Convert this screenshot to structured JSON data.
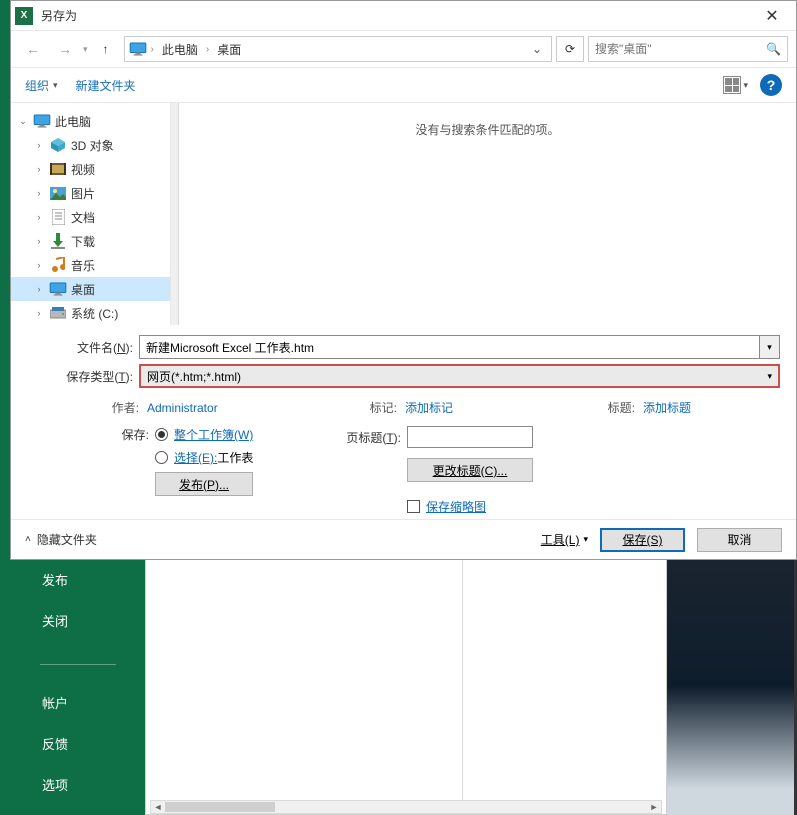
{
  "titlebar": {
    "title": "另存为"
  },
  "nav": {
    "crumb1": "此电脑",
    "crumb2": "桌面",
    "search_placeholder": "搜索\"桌面\""
  },
  "toolbar": {
    "organize": "组织",
    "new_folder": "新建文件夹"
  },
  "tree": {
    "root": "此电脑",
    "items": [
      {
        "label": "3D 对象",
        "icon": "cube"
      },
      {
        "label": "视频",
        "icon": "video"
      },
      {
        "label": "图片",
        "icon": "picture"
      },
      {
        "label": "文档",
        "icon": "doc"
      },
      {
        "label": "下载",
        "icon": "download"
      },
      {
        "label": "音乐",
        "icon": "music"
      },
      {
        "label": "桌面",
        "icon": "desktop",
        "selected": true
      },
      {
        "label": "系统 (C:)",
        "icon": "disk"
      }
    ]
  },
  "file_area": {
    "empty_text": "没有与搜索条件匹配的项。"
  },
  "form": {
    "filename_label_pre": "文件名(",
    "filename_label_u": "N",
    "filename_label_post": "):",
    "filename_value": "新建Microsoft Excel 工作表.htm",
    "save_type_label_pre": "保存类型(",
    "save_type_label_u": "T",
    "save_type_label_post": "):",
    "save_type_value": "网页(*.htm;*.html)"
  },
  "meta": {
    "author_label": "作者:",
    "author_value": "Administrator",
    "tag_label": "标记:",
    "tag_value": "添加标记",
    "title_label": "标题:",
    "title_value": "添加标题"
  },
  "options": {
    "save_label": "保存:",
    "opt_workbook": "整个工作簿(W)",
    "opt_selection_pre": "选择(E):",
    "opt_selection_post": "工作表",
    "publish_btn": "发布(P)...",
    "page_title_label_pre": "页标题(",
    "page_title_label_u": "T",
    "page_title_label_post": "):",
    "change_title_btn": "更改标题(C)...",
    "thumbnail_label": "保存缩略图"
  },
  "bottom": {
    "hide_folders": "隐藏文件夹",
    "tools": "工具(L)",
    "save_btn": "保存(S)",
    "cancel_btn": "取消"
  },
  "bg_sidebar": {
    "publish": "发布",
    "close": "关闭",
    "account": "帐户",
    "feedback": "反馈",
    "options": "选项"
  }
}
